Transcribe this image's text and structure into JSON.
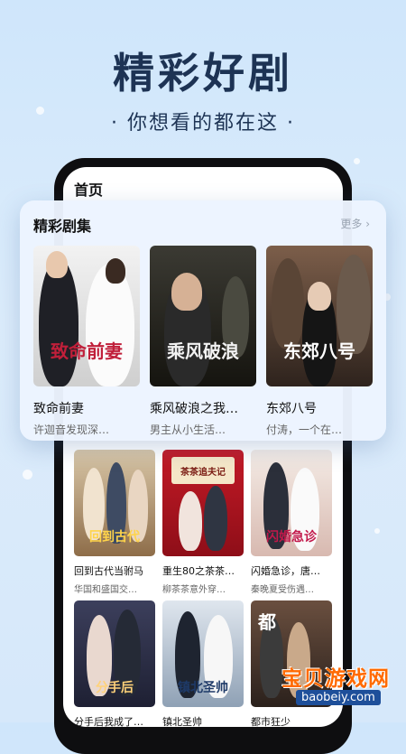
{
  "hero": {
    "title": "精彩好剧",
    "subtitle": "· 你想看的都在这 ·"
  },
  "screen": {
    "title": "首页"
  },
  "featured": {
    "title": "精彩剧集",
    "more_label": "更多 ›",
    "items": [
      {
        "name": "致命前妻",
        "desc": "许迦音发现深…",
        "poster_text": "致命前妻"
      },
      {
        "name": "乘风破浪之我…",
        "desc": "男主从小生活…",
        "poster_text": "乘风破浪"
      },
      {
        "name": "东郊八号",
        "desc": "付涛，一个在…",
        "poster_text": "东郊八号"
      }
    ]
  },
  "grid": [
    {
      "name": "回到古代当驸马",
      "desc": "华国和盛国交…",
      "poster_text": "回到古代"
    },
    {
      "name": "重生80之茶茶…",
      "desc": "柳茶茶意外穿…",
      "poster_text": "茶茶追夫记"
    },
    {
      "name": "闪婚急诊，唐…",
      "desc": "秦晚夏受伤遇…",
      "poster_text": "闪婚急诊"
    },
    {
      "name": "分手后我成了…",
      "desc": "",
      "poster_text": "分手后"
    },
    {
      "name": "镇北圣帅",
      "desc": "",
      "poster_text": "镇北圣帅"
    },
    {
      "name": "都市狂少",
      "desc": "",
      "poster_text": "都"
    }
  ],
  "watermark": {
    "text": "宝贝游戏网",
    "url": "baobeiy.com"
  },
  "colors": {
    "hero_text": "#1d3354",
    "accent_red": "#d3122a",
    "watermark": "#ff6a00"
  }
}
